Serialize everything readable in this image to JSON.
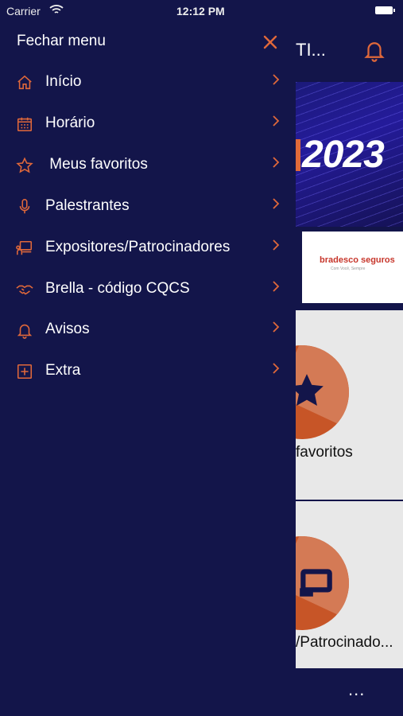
{
  "status_bar": {
    "carrier": "Carrier",
    "time": "12:12 PM"
  },
  "background": {
    "title": "TI...",
    "banner_year": "2023",
    "sponsor": {
      "name": "bradesco seguros",
      "tagline": "Com Você, Sempre"
    },
    "cards": [
      {
        "label": "favoritos"
      },
      {
        "label": "/Patrocinado..."
      }
    ],
    "tab_more": "..."
  },
  "drawer": {
    "close_label": "Fechar menu",
    "items": [
      {
        "label": "Início",
        "icon": "home-icon"
      },
      {
        "label": "Horário",
        "icon": "calendar-icon"
      },
      {
        "label": " Meus favoritos",
        "icon": "star-icon"
      },
      {
        "label": "Palestrantes",
        "icon": "microphone-icon"
      },
      {
        "label": "Expositores/Patrocinadores",
        "icon": "exhibitor-icon"
      },
      {
        "label": "Brella - código CQCS",
        "icon": "handshake-icon"
      },
      {
        "label": "Avisos",
        "icon": "bell-icon"
      },
      {
        "label": "Extra",
        "icon": "plus-square-icon"
      }
    ]
  },
  "colors": {
    "accent": "#e0683a",
    "background": "#13154a",
    "text": "#ffffff"
  }
}
